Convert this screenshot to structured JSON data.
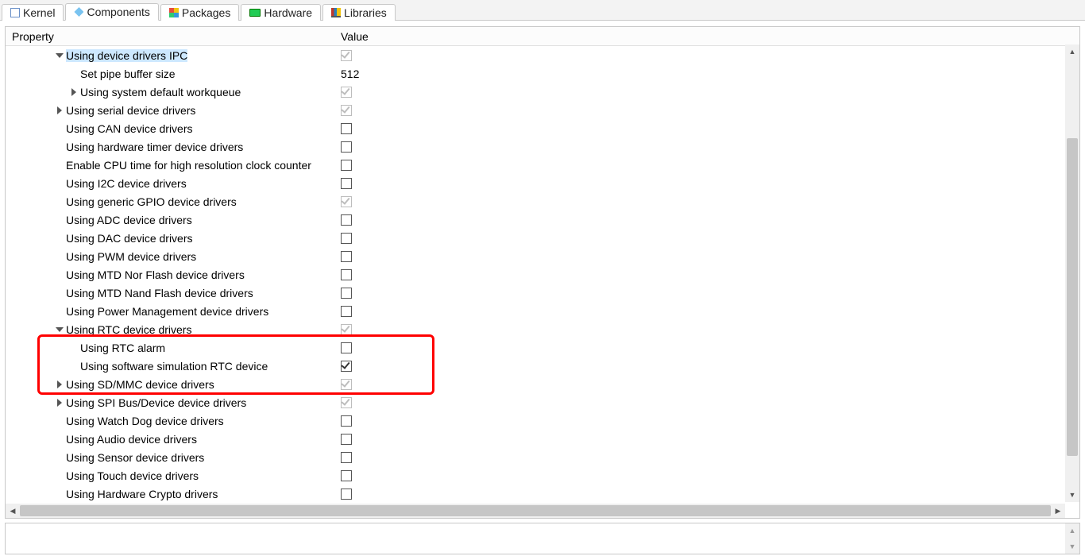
{
  "tabs": [
    {
      "label": "Kernel",
      "icon": "kernel-icon"
    },
    {
      "label": "Components",
      "icon": "components-icon",
      "active": true
    },
    {
      "label": "Packages",
      "icon": "packages-icon"
    },
    {
      "label": "Hardware",
      "icon": "hardware-icon"
    },
    {
      "label": "Libraries",
      "icon": "libraries-icon"
    }
  ],
  "columns": {
    "property": "Property",
    "value": "Value"
  },
  "rows": [
    {
      "indent": 3,
      "arrow": "down",
      "label": "Using device drivers IPC",
      "selected": true,
      "value": {
        "type": "check",
        "state": "checked-dim"
      }
    },
    {
      "indent": 4,
      "arrow": "none",
      "label": "Set pipe buffer size",
      "value": {
        "type": "text",
        "text": "512"
      }
    },
    {
      "indent": 4,
      "arrow": "right",
      "label": "Using system default workqueue",
      "value": {
        "type": "check",
        "state": "checked-dim"
      }
    },
    {
      "indent": 3,
      "arrow": "right",
      "label": "Using serial device drivers",
      "value": {
        "type": "check",
        "state": "checked-dim"
      }
    },
    {
      "indent": 3,
      "arrow": "none",
      "label": "Using CAN device drivers",
      "value": {
        "type": "check",
        "state": "unchecked"
      }
    },
    {
      "indent": 3,
      "arrow": "none",
      "label": "Using hardware timer device drivers",
      "value": {
        "type": "check",
        "state": "unchecked"
      }
    },
    {
      "indent": 3,
      "arrow": "none",
      "label": "Enable CPU time for high resolution clock counter",
      "value": {
        "type": "check",
        "state": "unchecked"
      }
    },
    {
      "indent": 3,
      "arrow": "none",
      "label": "Using I2C device drivers",
      "value": {
        "type": "check",
        "state": "unchecked"
      }
    },
    {
      "indent": 3,
      "arrow": "none",
      "label": "Using generic GPIO device drivers",
      "value": {
        "type": "check",
        "state": "checked-dim"
      }
    },
    {
      "indent": 3,
      "arrow": "none",
      "label": "Using ADC device drivers",
      "value": {
        "type": "check",
        "state": "unchecked"
      }
    },
    {
      "indent": 3,
      "arrow": "none",
      "label": "Using DAC device drivers",
      "value": {
        "type": "check",
        "state": "unchecked"
      }
    },
    {
      "indent": 3,
      "arrow": "none",
      "label": "Using PWM device drivers",
      "value": {
        "type": "check",
        "state": "unchecked"
      }
    },
    {
      "indent": 3,
      "arrow": "none",
      "label": "Using MTD Nor Flash device drivers",
      "value": {
        "type": "check",
        "state": "unchecked"
      }
    },
    {
      "indent": 3,
      "arrow": "none",
      "label": "Using MTD Nand Flash device drivers",
      "value": {
        "type": "check",
        "state": "unchecked"
      }
    },
    {
      "indent": 3,
      "arrow": "none",
      "label": "Using Power Management device drivers",
      "value": {
        "type": "check",
        "state": "unchecked"
      }
    },
    {
      "indent": 3,
      "arrow": "down",
      "label": "Using RTC device drivers",
      "value": {
        "type": "check",
        "state": "checked-dim"
      }
    },
    {
      "indent": 4,
      "arrow": "none",
      "label": "Using RTC alarm",
      "value": {
        "type": "check",
        "state": "unchecked"
      }
    },
    {
      "indent": 4,
      "arrow": "none",
      "label": "Using software simulation RTC device",
      "value": {
        "type": "check",
        "state": "checked"
      }
    },
    {
      "indent": 3,
      "arrow": "right",
      "label": "Using SD/MMC device drivers",
      "value": {
        "type": "check",
        "state": "checked-dim"
      }
    },
    {
      "indent": 3,
      "arrow": "right",
      "label": "Using SPI Bus/Device device drivers",
      "value": {
        "type": "check",
        "state": "checked-dim"
      }
    },
    {
      "indent": 3,
      "arrow": "none",
      "label": "Using Watch Dog device drivers",
      "value": {
        "type": "check",
        "state": "unchecked"
      }
    },
    {
      "indent": 3,
      "arrow": "none",
      "label": "Using Audio device drivers",
      "value": {
        "type": "check",
        "state": "unchecked"
      }
    },
    {
      "indent": 3,
      "arrow": "none",
      "label": "Using Sensor device drivers",
      "value": {
        "type": "check",
        "state": "unchecked"
      }
    },
    {
      "indent": 3,
      "arrow": "none",
      "label": "Using Touch device drivers",
      "value": {
        "type": "check",
        "state": "unchecked"
      }
    },
    {
      "indent": 3,
      "arrow": "none",
      "label": "Using Hardware Crypto drivers",
      "value": {
        "type": "check",
        "state": "unchecked"
      }
    }
  ]
}
